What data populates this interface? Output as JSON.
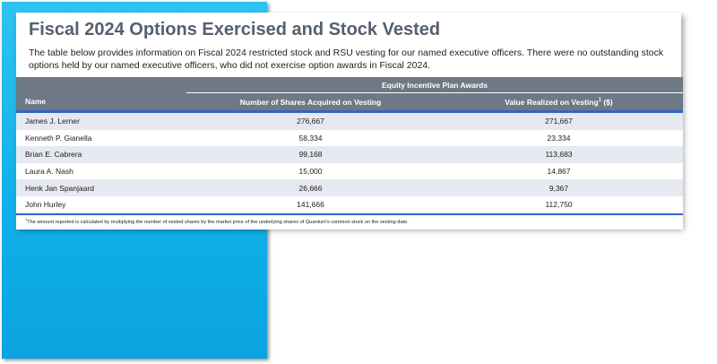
{
  "title": "Fiscal 2024 Options Exercised and Stock Vested",
  "description": "The table below provides information on Fiscal 2024 restricted stock and RSU vesting for our named executive officers.  There were no outstanding stock options held by our named executive officers, who did not exercise option awards in Fiscal 2024.",
  "table": {
    "group_header": "Equity Incentive Plan Awards",
    "columns": {
      "name": "Name",
      "shares": "Number of Shares Acquired on Vesting",
      "value": "Value Realized on Vesting",
      "value_sup": "1",
      "value_suffix": " ($)"
    },
    "rows": [
      {
        "name": "James J. Lerner",
        "shares": "276,667",
        "value": "271,667"
      },
      {
        "name": "Kenneth P. Gianella",
        "shares": "58,334",
        "value": "23,334"
      },
      {
        "name": "Brian E. Cabrera",
        "shares": "99,168",
        "value": "113,683"
      },
      {
        "name": "Laura A. Nash",
        "shares": "15,000",
        "value": "14,867"
      },
      {
        "name": "Henk Jan Spanjaard",
        "shares": "26,666",
        "value": "9,367"
      },
      {
        "name": "John Hurley",
        "shares": "141,666",
        "value": "112,750"
      }
    ],
    "footnote_sup": "1",
    "footnote": "The amount reported is calculated by multiplying the number of vested shares by the market price of the underlying shares of Quantum's common stock on the vesting date."
  }
}
